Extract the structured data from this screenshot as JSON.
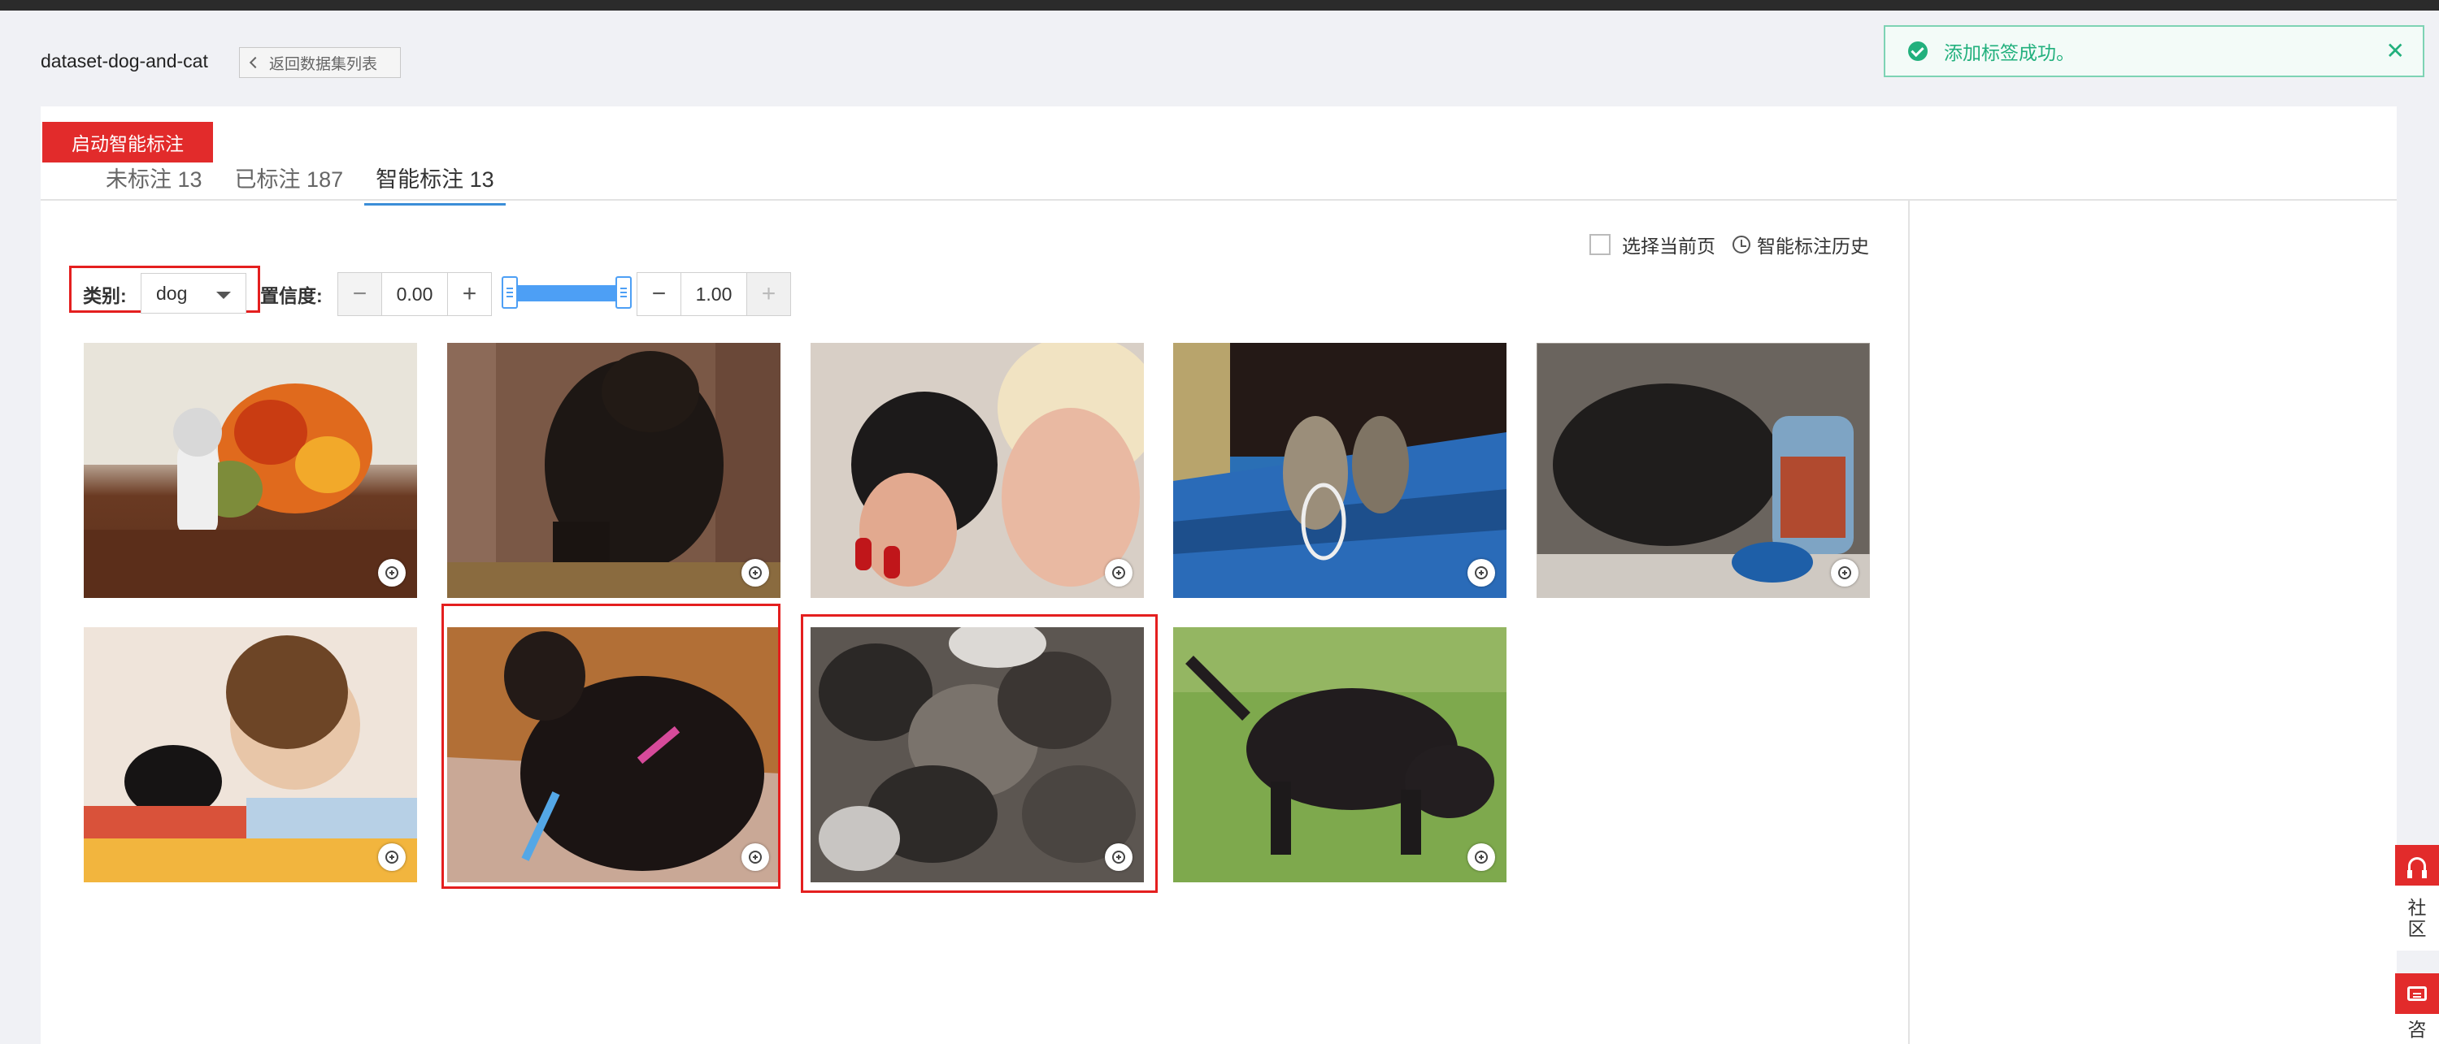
{
  "header": {
    "dataset_name": "dataset-dog-and-cat",
    "back_label": "返回数据集列表"
  },
  "toast": {
    "message": "添加标签成功。",
    "close": "✕",
    "color": "#22b07d"
  },
  "tabs": [
    {
      "label": "未标注 13",
      "active": false
    },
    {
      "label": "已标注 187",
      "active": false
    },
    {
      "label": "智能标注 13",
      "active": true
    }
  ],
  "toolbar": {
    "start_label": "启动智能标注",
    "category_label": "类别:",
    "category_value": "dog",
    "confidence_label": "置信度:",
    "confidence_min": "0.00",
    "confidence_max": "1.00",
    "minus": "−",
    "plus": "+",
    "select_page_label": "选择当前页",
    "history_label": "智能标注历史"
  },
  "images": [
    {
      "alt": "cat doll with flowers",
      "highlighted": false
    },
    {
      "alt": "black dog",
      "highlighted": false
    },
    {
      "alt": "woman kissing black kitten",
      "highlighted": false
    },
    {
      "alt": "tabby kittens on blue floor",
      "highlighted": false
    },
    {
      "alt": "black puppy near feeder",
      "highlighted": false
    },
    {
      "alt": "girl with kitten in bed",
      "highlighted": false
    },
    {
      "alt": "black cat on rug",
      "highlighted": true
    },
    {
      "alt": "pile of kittens",
      "highlighted": true
    },
    {
      "alt": "black dog on grass",
      "highlighted": false
    }
  ],
  "side_float": {
    "community_label_1": "社",
    "community_label_2": "区",
    "consult_label": "咨"
  },
  "accent_colors": {
    "primary_red": "#e22b2b",
    "highlight_red": "#e41f1f",
    "tab_blue": "#3b8ed8",
    "slider_blue": "#4d9ff5"
  }
}
